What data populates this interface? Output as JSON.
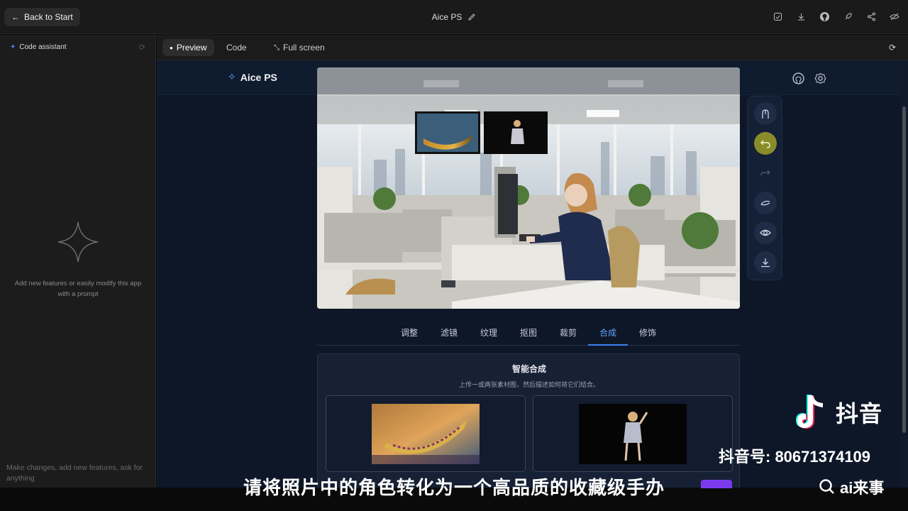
{
  "topbar": {
    "back_label": "Back to Start",
    "app_title": "Aice PS",
    "actions": [
      "save-icon",
      "download-icon",
      "github-icon",
      "deploy-icon",
      "share-icon",
      "hide-icon"
    ]
  },
  "left_panel": {
    "title": "Code assistant",
    "empty_text": "Add new features or easily modify this app with a prompt",
    "prompt_placeholder": "Make changes, add new features, ask for anything"
  },
  "main_tabs": {
    "preview": "Preview",
    "code": "Code",
    "fullscreen": "Full screen"
  },
  "app": {
    "name": "Aice PS",
    "tools": [
      "hand-icon",
      "undo-icon",
      "redo-icon",
      "compare-icon",
      "eye-icon",
      "download-icon"
    ],
    "active_tool": "undo-icon",
    "tabs": [
      "调整",
      "滤镜",
      "纹理",
      "抠图",
      "裁剪",
      "合成",
      "修饰"
    ],
    "active_tab": "合成",
    "compose": {
      "title": "智能合成",
      "subtitle": "上传一或两张素材图，然后描述如何将它们结合。"
    }
  },
  "overlay": {
    "brand": "抖音",
    "account": "抖音号: 80671374109",
    "search": "ai来事",
    "subtitle": "请将照片中的角色转化为一个高品质的收藏级手办"
  },
  "colors": {
    "accent_blue": "#3b82f6",
    "active_tool": "#8a8c2a",
    "app_bg": "#0e1728"
  }
}
